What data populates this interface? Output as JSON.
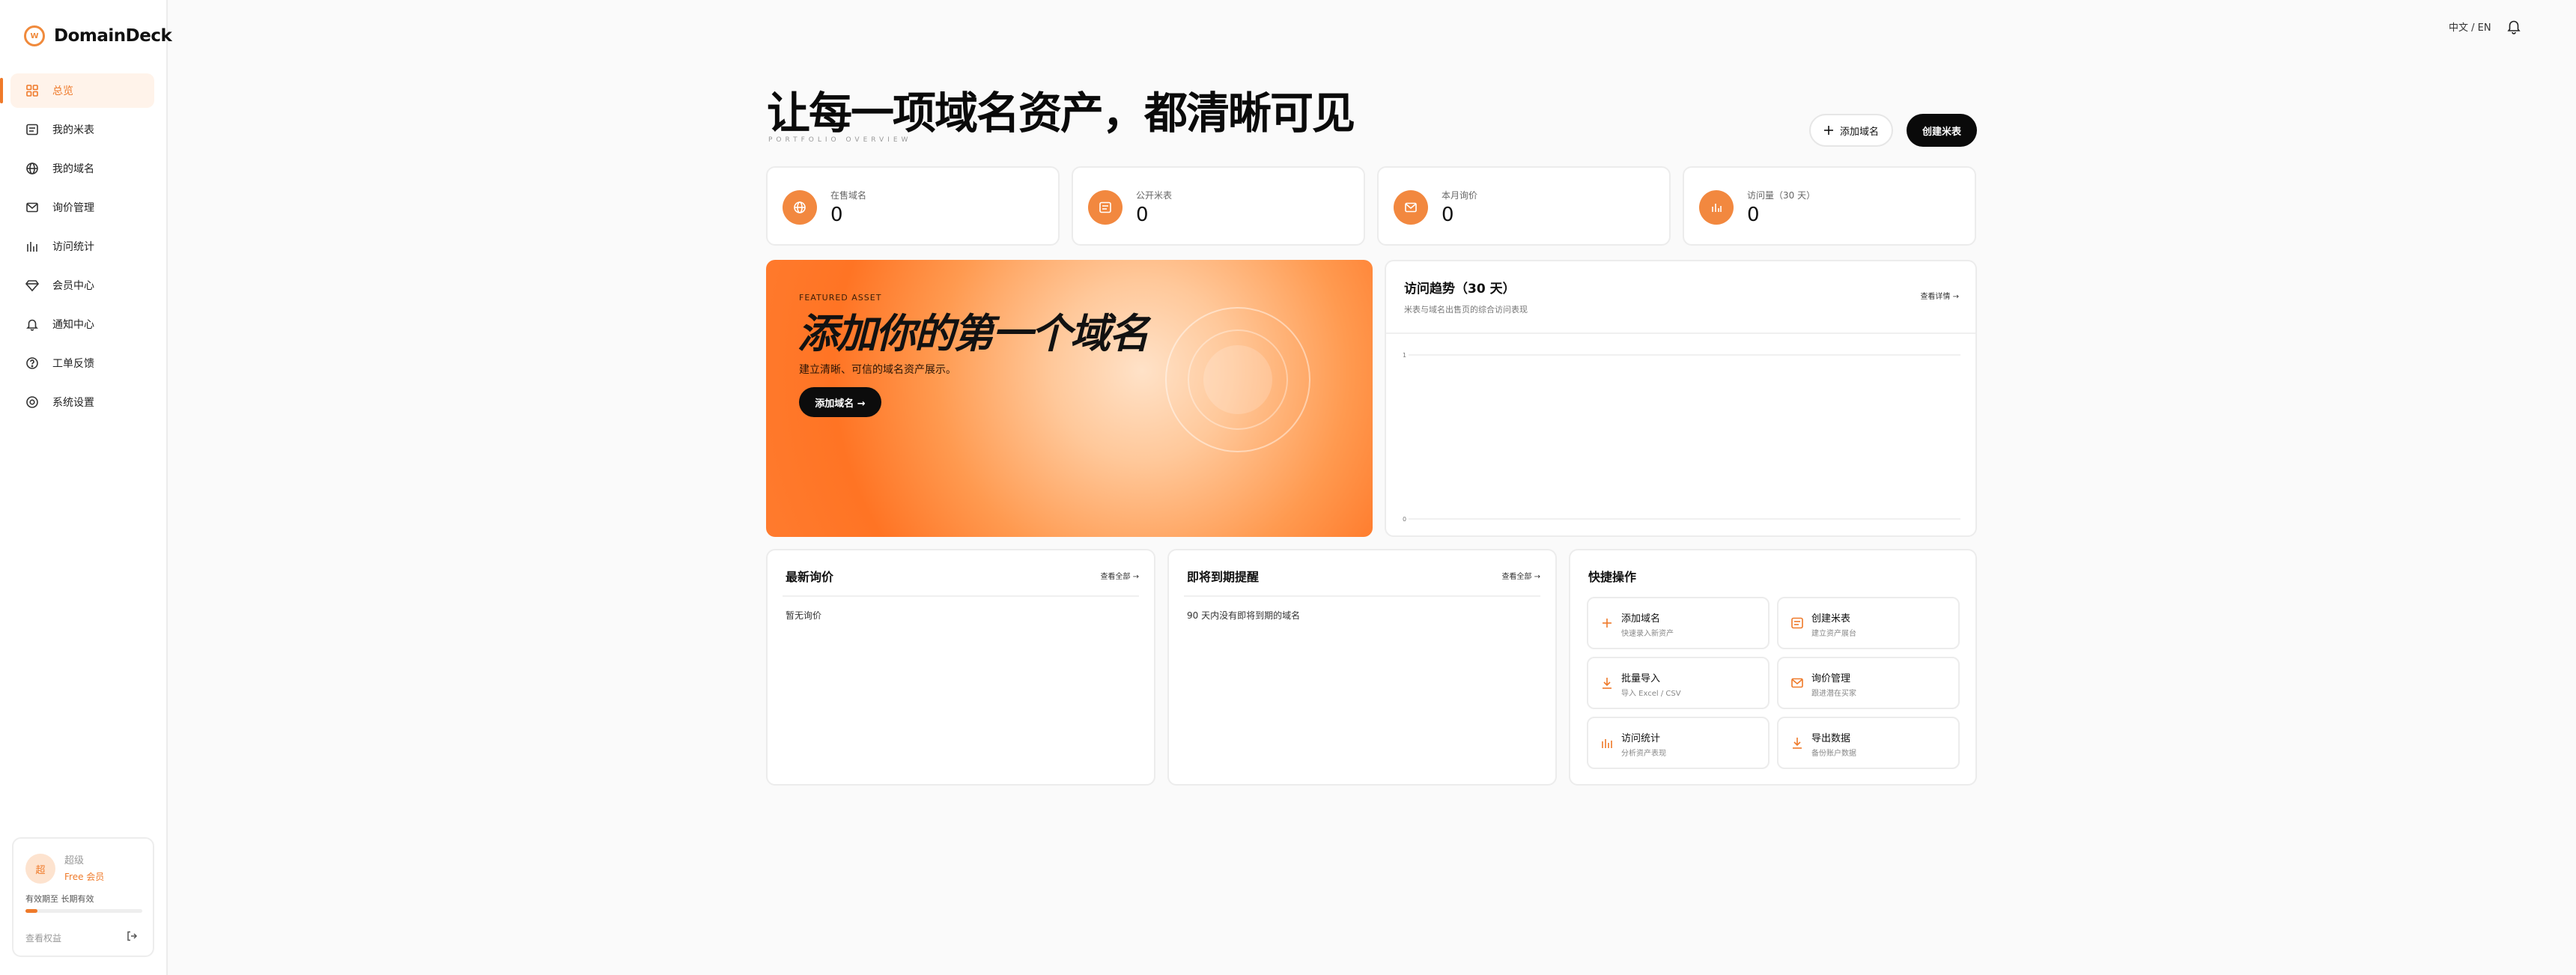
{
  "brand": {
    "name": "DomainDeck",
    "logo_text": "W"
  },
  "sidebar": {
    "items": [
      {
        "label": "总览",
        "icon": "grid-icon"
      },
      {
        "label": "我的米表",
        "icon": "list-icon"
      },
      {
        "label": "我的域名",
        "icon": "globe-icon"
      },
      {
        "label": "询价管理",
        "icon": "mail-icon"
      },
      {
        "label": "访问统计",
        "icon": "bar-chart-icon"
      },
      {
        "label": "会员中心",
        "icon": "diamond-icon"
      },
      {
        "label": "通知中心",
        "icon": "bell-icon"
      },
      {
        "label": "工单反馈",
        "icon": "help-circle-icon"
      },
      {
        "label": "系统设置",
        "icon": "settings-icon"
      }
    ],
    "member": {
      "avatar": "超",
      "name": "超级",
      "tier": "Free 会员",
      "expiry": "有效期至 长期有效",
      "link": "查看权益",
      "progress": 0.1
    }
  },
  "topbar": {
    "language": "中文 / EN"
  },
  "hero": {
    "title": "让每一项域名资产，都清晰可见",
    "subtitle": "PORTFOLIO OVERVIEW",
    "add_domain_label": "添加域名",
    "create_label": "创建米表"
  },
  "stats": [
    {
      "label": "在售域名",
      "value": "0"
    },
    {
      "label": "公开米表",
      "value": "0"
    },
    {
      "label": "本月询价",
      "value": "0"
    },
    {
      "label": "访问量（30 天）",
      "value": "0"
    }
  ],
  "banner": {
    "tag": "FEATURED ASSET",
    "title": "添加你的第一个域名",
    "description": "建立清晰、可信的域名资产展示。",
    "button": "添加域名 →"
  },
  "trend": {
    "title": "访问趋势（30 天）",
    "subtitle": "米表与域名出售页的综合访问表现",
    "link": "查看详情 →"
  },
  "chart_data": {
    "type": "line",
    "title": "访问趋势（30 天）",
    "xlabel": "",
    "ylabel": "",
    "ylim": [
      0,
      1
    ],
    "yticks": [
      "1",
      "0"
    ],
    "series": [],
    "grid": true
  },
  "inquiries": {
    "title": "最新询价",
    "link": "查看全部 →",
    "empty": "暂无询价"
  },
  "expiring": {
    "title": "即将到期提醒",
    "link": "查看全部 →",
    "empty": "90 天内没有即将到期的域名"
  },
  "quick_actions": {
    "title": "快捷操作",
    "items": [
      {
        "label": "添加域名",
        "desc": "快速录入新资产",
        "icon": "plus-icon"
      },
      {
        "label": "创建米表",
        "desc": "建立资产展台",
        "icon": "list-icon"
      },
      {
        "label": "批量导入",
        "desc": "导入 Excel / CSV",
        "icon": "download-icon"
      },
      {
        "label": "询价管理",
        "desc": "跟进潜在买家",
        "icon": "mail-icon"
      },
      {
        "label": "访问统计",
        "desc": "分析资产表现",
        "icon": "bar-chart-icon"
      },
      {
        "label": "导出数据",
        "desc": "备份账户数据",
        "icon": "export-icon"
      }
    ]
  },
  "colors": {
    "accent": "#ef7a2a",
    "dark": "#0a0a0a"
  }
}
